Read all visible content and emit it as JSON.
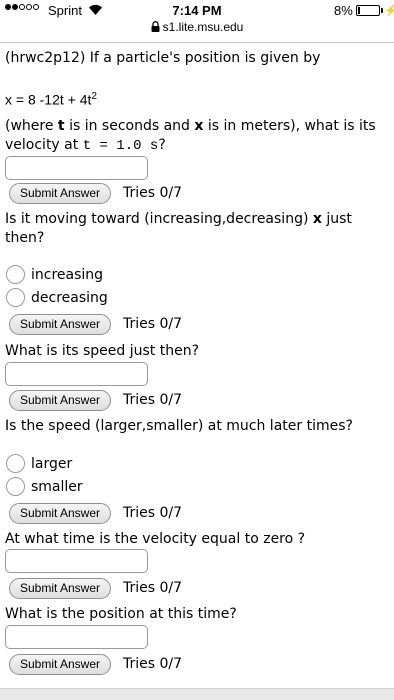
{
  "status_bar": {
    "carrier": "Sprint",
    "time": "7:14 PM",
    "battery": "8%"
  },
  "browser": {
    "url": "s1.lite.msu.edu"
  },
  "problem": {
    "intro": "(hrwc2p12) If a particle's position is given by",
    "formula": {
      "base": "x = 8 -12t + 4t",
      "exponent": "2"
    },
    "q1": {
      "line1": {
        "pre": "(where ",
        "b1": "t",
        "mid": " is in seconds and ",
        "b2": "x",
        "post": " is in meters), what is its"
      },
      "line2": {
        "pre": "velocity at ",
        "math": "t = 1.0 s",
        "post": "?"
      },
      "button": "Submit Answer",
      "tries": "Tries 0/7"
    },
    "q2": {
      "line1": {
        "pre": "Is it moving toward (increasing,decreasing) ",
        "bold": "x",
        "post": " just"
      },
      "line2": "then?",
      "options": [
        "increasing",
        "decreasing"
      ],
      "button": "Submit Answer",
      "tries": "Tries 0/7"
    },
    "q3": {
      "question": "What is its speed just then?",
      "button": "Submit Answer",
      "tries": "Tries 0/7"
    },
    "q4": {
      "question": "Is the speed (larger,smaller) at much later times?",
      "options": [
        "larger",
        "smaller"
      ],
      "button": "Submit Answer",
      "tries": "Tries 0/7"
    },
    "q5": {
      "question": "At what time is the velocity equal to zero ?",
      "button": "Submit Answer",
      "tries": "Tries 0/7"
    },
    "q6": {
      "question": "What is the position at this time?",
      "button": "Submit Answer",
      "tries": "Tries 0/7"
    }
  }
}
